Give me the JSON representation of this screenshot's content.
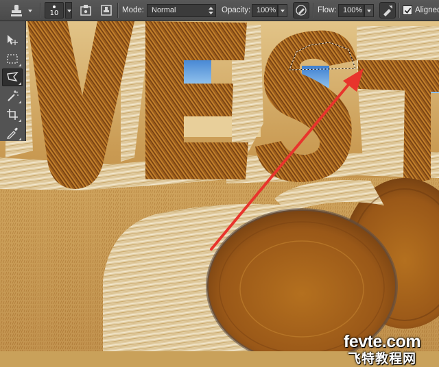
{
  "options_bar": {
    "brush_size": "10",
    "mode_label": "Mode:",
    "mode_value": "Normal",
    "opacity_label": "Opacity:",
    "opacity_value": "100%",
    "flow_label": "Flow:",
    "flow_value": "100%",
    "aligned_label": "Aligned",
    "aligned_checked": true
  },
  "tools": [
    {
      "name": "move-tool",
      "icon": "move-icon"
    },
    {
      "name": "rectangular-marquee-tool",
      "icon": "marquee-icon"
    },
    {
      "name": "polygonal-lasso-tool",
      "icon": "polygonal-lasso-icon",
      "active": true
    },
    {
      "name": "magic-wand-tool",
      "icon": "magic-wand-icon"
    },
    {
      "name": "crop-tool",
      "icon": "crop-icon"
    },
    {
      "name": "eyedropper-tool",
      "icon": "eyedropper-icon"
    }
  ],
  "canvas": {
    "artwork_text": "VEST",
    "accent_color": "#e8342c"
  },
  "watermark": {
    "line1": "fevte.com",
    "line2": "飞特教程网"
  }
}
